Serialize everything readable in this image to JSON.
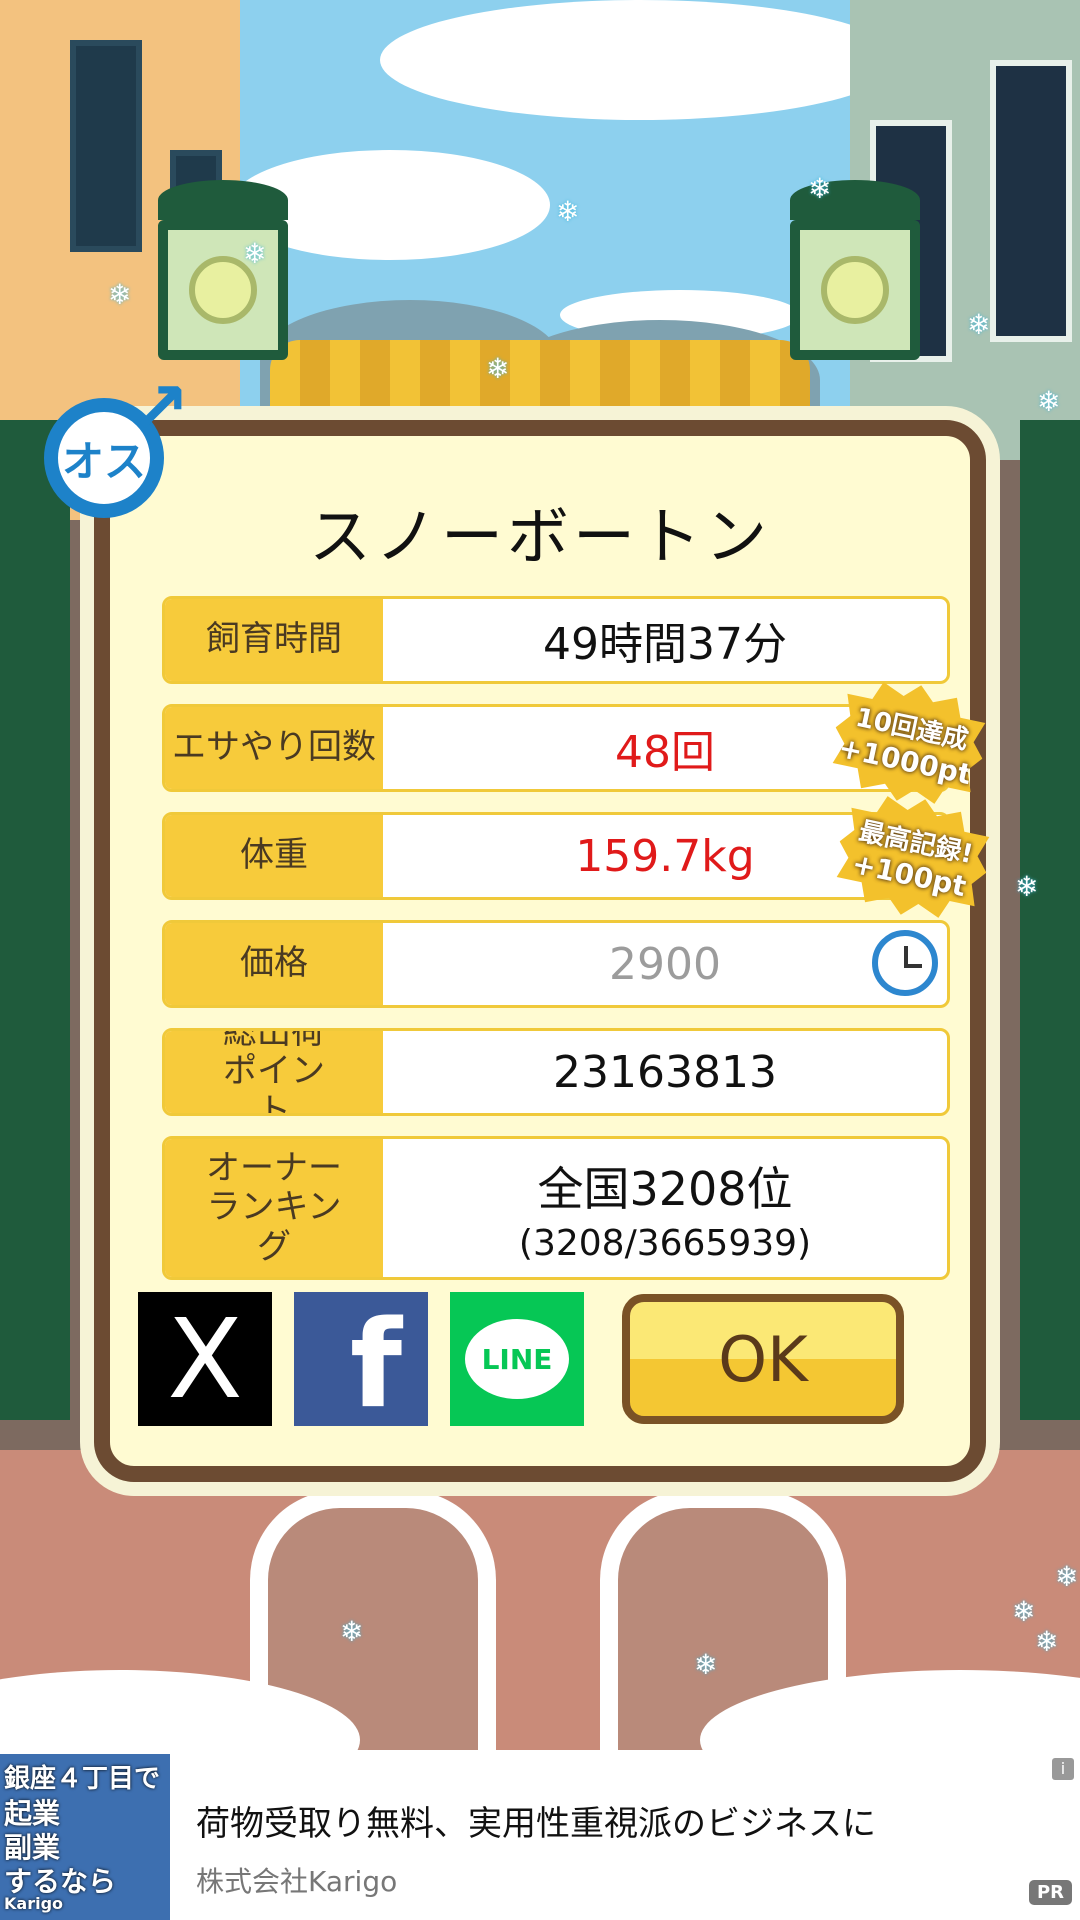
{
  "dialog": {
    "gender_badge": "オス",
    "pet_name": "スノーボートン",
    "rows": [
      {
        "label": "飼育時間",
        "value": "49時間37分"
      },
      {
        "label": "エサやり回数",
        "value": "48回"
      },
      {
        "label": "体重",
        "value": "159.7kg"
      },
      {
        "label": "価格",
        "value": "2900"
      },
      {
        "label": "総出荷ポイント",
        "value": "23163813"
      },
      {
        "label": "オーナーランキング",
        "value": "全国3208位",
        "detail": "(3208/3665939)"
      }
    ],
    "badges": [
      {
        "line1": "10回達成",
        "line2": "+1000pt"
      },
      {
        "line1": "最高記録!",
        "line2": "+100pt"
      }
    ],
    "share": {
      "x": "X",
      "facebook": "f",
      "line": "LINE"
    },
    "ok_label": "OK"
  },
  "ad": {
    "image_text": [
      "銀座４丁目で",
      "起業",
      "副業",
      "するなら"
    ],
    "image_logo": "Karigo",
    "headline": "荷物受取り無料、実用性重視派のビジネスに",
    "sponsor": "株式会社Karigo",
    "info": "i",
    "pr": "PR"
  },
  "colors": {
    "accent_yellow": "#f7cb3b",
    "frame_brown": "#6c4b32",
    "red_value": "#e01a1a",
    "male_blue": "#1d82c9"
  }
}
